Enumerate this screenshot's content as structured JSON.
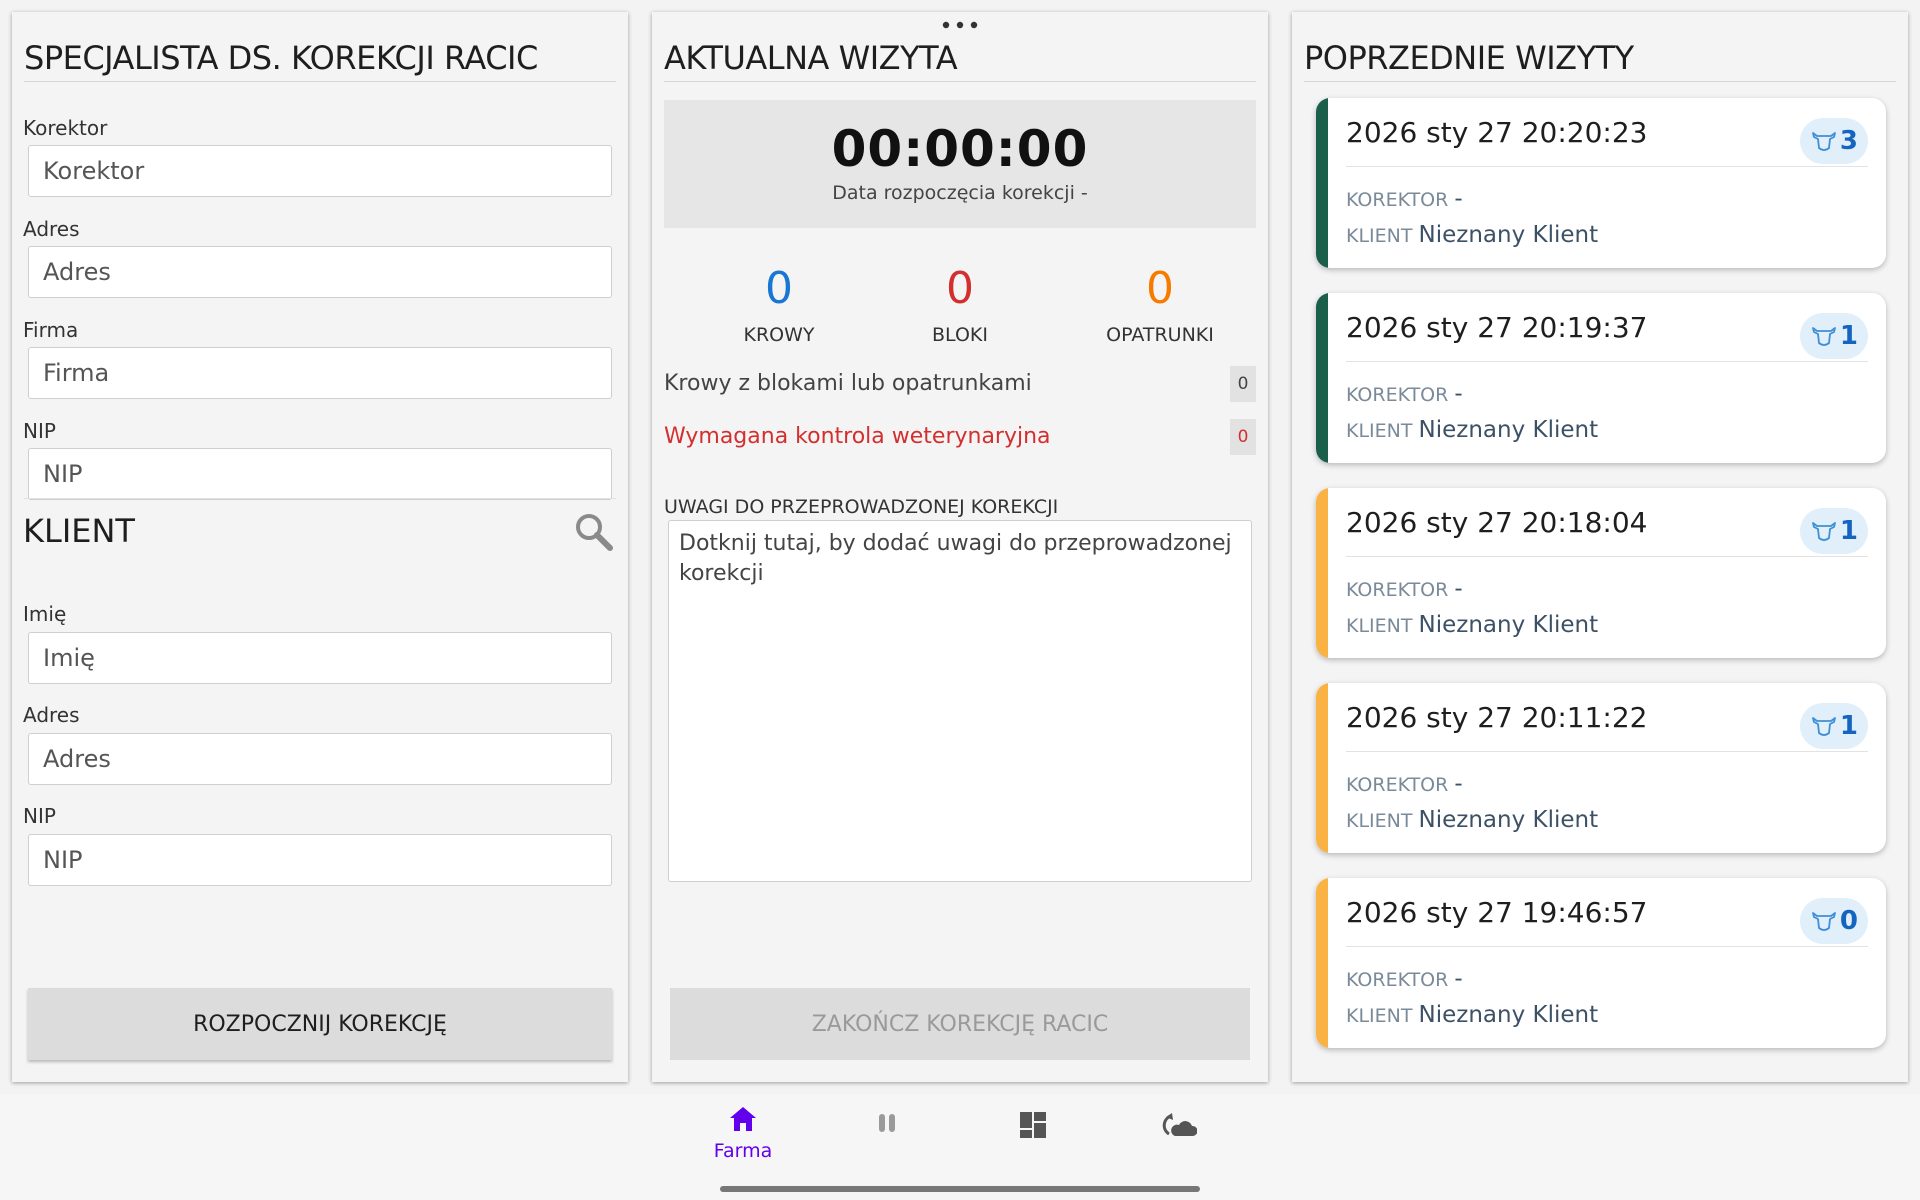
{
  "left_panel": {
    "title": "SPECJALISTA DS. KOREKCJI RACIC",
    "fields": [
      {
        "label": "Korektor",
        "placeholder": "Korektor"
      },
      {
        "label": "Adres",
        "placeholder": "Adres"
      },
      {
        "label": "Firma",
        "placeholder": "Firma"
      },
      {
        "label": "NIP",
        "placeholder": "NIP"
      }
    ],
    "client_section": {
      "title": "KLIENT",
      "search_icon": "search-icon",
      "fields": [
        {
          "label": "Imię",
          "placeholder": "Imię"
        },
        {
          "label": "Adres",
          "placeholder": "Adres"
        },
        {
          "label": "NIP",
          "placeholder": "NIP"
        }
      ]
    },
    "start_button": "ROZPOCZNIJ KOREKCJĘ"
  },
  "middle_panel": {
    "title": "AKTUALNA WIZYTA",
    "timer": "00:00:00",
    "start_date_label": "Data rozpoczęcia korekcji -",
    "stats": [
      {
        "value": "0",
        "label": "KROWY",
        "color": "#1976d2"
      },
      {
        "value": "0",
        "label": "BLOKI",
        "color": "#d32f2f"
      },
      {
        "value": "0",
        "label": "OPATRUNKI",
        "color": "#f57c00"
      }
    ],
    "counts": [
      {
        "label": "Krowy z blokami lub opatrunkami",
        "value": "0",
        "color": "#444444"
      },
      {
        "label": "Wymagana kontrola weterynaryjna",
        "value": "0",
        "color": "#d32f2f"
      }
    ],
    "notes_label": "UWAGI DO PRZEPROWADZONEJ KOREKCJI",
    "notes_placeholder": "Dotknij tutaj, by dodać uwagi do przeprowadzonej korekcji",
    "end_button": "ZAKOŃCZ KOREKCJĘ RACIC"
  },
  "right_panel": {
    "title": "POPRZEDNIE WIZYTY",
    "visits": [
      {
        "date": "2026 sty 27 20:20:23",
        "cows": "3",
        "korektor_label": "KOREKTOR",
        "korektor": "-",
        "klient_label": "KLIENT",
        "klient": "Nieznany Klient",
        "status_color": "#1b5e4a"
      },
      {
        "date": "2026 sty 27 20:19:37",
        "cows": "1",
        "korektor_label": "KOREKTOR",
        "korektor": "-",
        "klient_label": "KLIENT",
        "klient": "Nieznany Klient",
        "status_color": "#1b5e4a"
      },
      {
        "date": "2026 sty 27 20:18:04",
        "cows": "1",
        "korektor_label": "KOREKTOR",
        "korektor": "-",
        "klient_label": "KLIENT",
        "klient": "Nieznany Klient",
        "status_color": "#fbb244"
      },
      {
        "date": "2026 sty 27 20:11:22",
        "cows": "1",
        "korektor_label": "KOREKTOR",
        "korektor": "-",
        "klient_label": "KLIENT",
        "klient": "Nieznany Klient",
        "status_color": "#fbb244"
      },
      {
        "date": "2026 sty 27 19:46:57",
        "cows": "0",
        "korektor_label": "KOREKTOR",
        "korektor": "-",
        "klient_label": "KLIENT",
        "klient": "Nieznany Klient",
        "status_color": "#fbb244"
      }
    ]
  },
  "bottom_nav": {
    "items": [
      {
        "label": "Farma",
        "icon": "home-icon",
        "active": true
      },
      {
        "label": "",
        "icon": "pause-icon",
        "active": false
      },
      {
        "label": "",
        "icon": "dashboard-icon",
        "active": false
      },
      {
        "label": "",
        "icon": "cloud-sync-icon",
        "active": false
      }
    ],
    "active_color": "#6200ee",
    "inactive_color": "#555555"
  }
}
